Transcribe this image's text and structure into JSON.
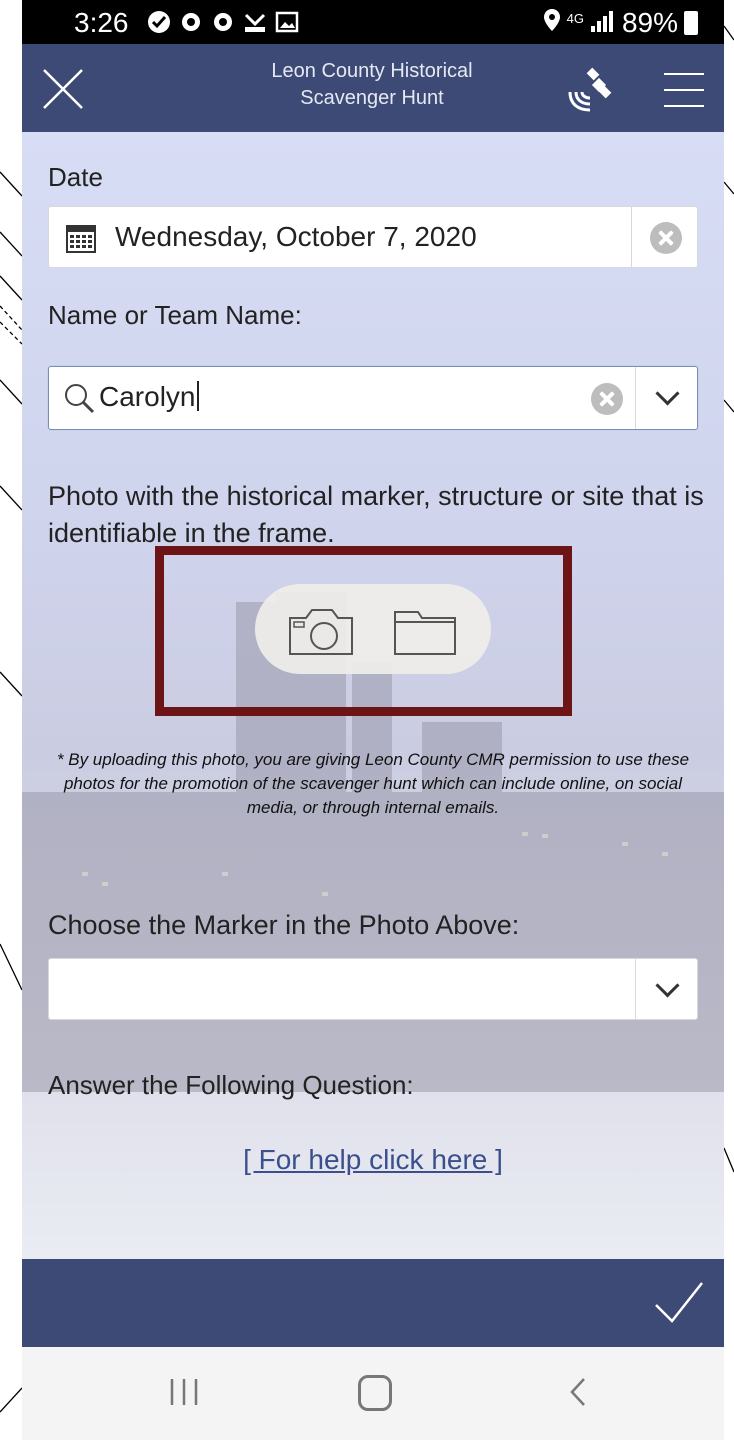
{
  "status_bar": {
    "time": "3:26",
    "network": "4G",
    "battery": "89%"
  },
  "header": {
    "title_line1": "Leon County Historical",
    "title_line2": "Scavenger Hunt",
    "icons": [
      "close-icon",
      "satellite-icon",
      "menu-icon"
    ]
  },
  "form": {
    "date_label": "Date",
    "date_value": "Wednesday, October 7, 2020",
    "name_label": "Name or Team Name:",
    "name_value": "Carolyn",
    "photo_label": "Photo with the historical marker, structure or site that is identifiable in the frame.",
    "disclaimer": "* By uploading this photo, you are giving Leon County CMR permission to use these photos for the promotion of the scavenger hunt which can include online, on social media, or through internal emails.",
    "marker_label": "Choose the Marker in the Photo Above:",
    "marker_value": "",
    "question_label": "Answer the Following Question:",
    "help_link": "[ For help click here ]"
  },
  "colors": {
    "header_bg": "#3c4a75",
    "highlight_box": "#6d1416",
    "link": "#3b4f8c"
  }
}
